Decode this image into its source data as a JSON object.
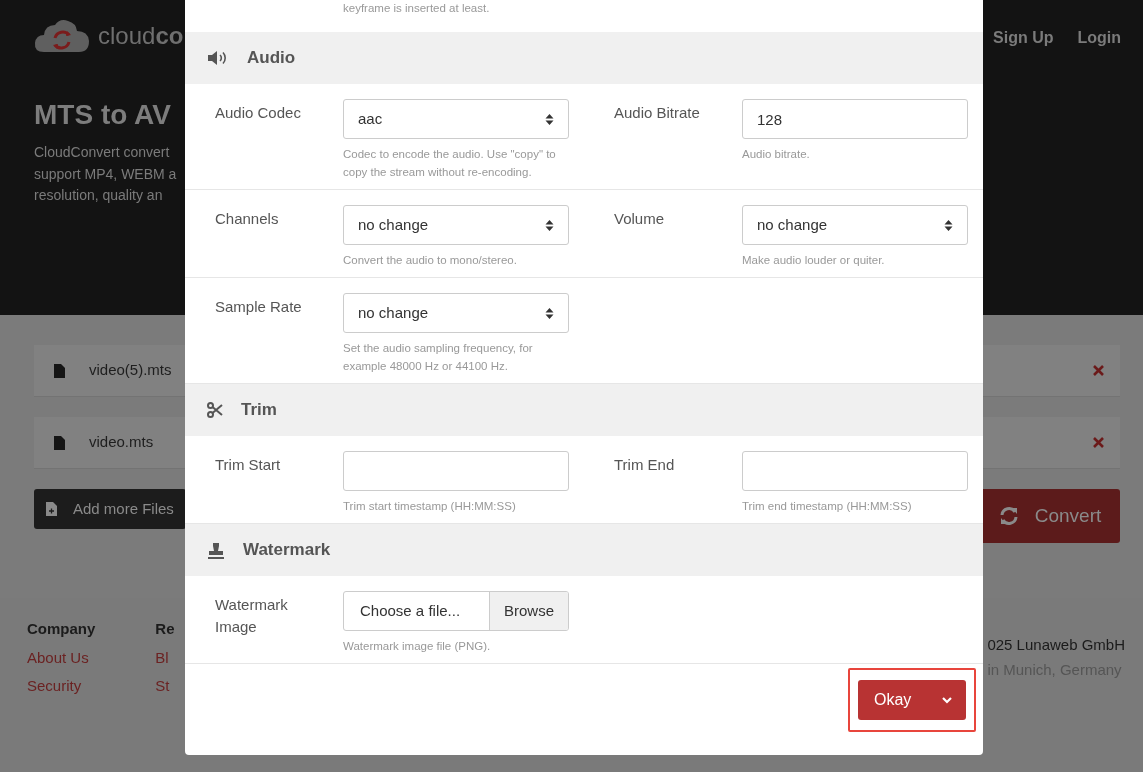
{
  "page": {
    "logo": {
      "regular": "cloud",
      "bold": "co"
    },
    "nav": [
      "Sign Up",
      "Login"
    ],
    "title": "MTS to AV",
    "description": [
      "CloudConvert convert",
      "support MP4, WEBM a",
      "resolution, quality an"
    ],
    "files": [
      {
        "name": "video(5).mts"
      },
      {
        "name": "video.mts"
      }
    ],
    "add_button": "Add more Files",
    "convert_button": "Convert",
    "footer": {
      "columns": [
        {
          "heading": "Company",
          "links": [
            "About Us",
            "Security"
          ]
        },
        {
          "heading": "Re",
          "links": [
            "Bl",
            "St"
          ]
        }
      ],
      "copyright": "025 Lunaweb GmbH",
      "location": "in Munich, Germany"
    }
  },
  "dialog": {
    "top_note": "keyframe is inserted at least.",
    "sections": [
      {
        "title": "Audio",
        "rows": [
          [
            {
              "label": "Audio Codec",
              "kind": "select",
              "value": "aac",
              "help": "Codec to encode the audio. Use \"copy\" to copy the stream without re-encoding."
            },
            {
              "label": "Audio Bitrate",
              "kind": "text",
              "value": "128",
              "help": "Audio bitrate."
            }
          ],
          [
            {
              "label": "Channels",
              "kind": "select",
              "value": "no change",
              "help": "Convert the audio to mono/stereo."
            },
            {
              "label": "Volume",
              "kind": "select",
              "value": "no change",
              "help": "Make audio louder or quiter."
            }
          ],
          [
            {
              "label": "Sample Rate",
              "kind": "select",
              "value": "no change",
              "help": "Set the audio sampling frequency, for example 48000 Hz or 44100 Hz."
            }
          ]
        ]
      },
      {
        "title": "Trim",
        "rows": [
          [
            {
              "label": "Trim Start",
              "kind": "text",
              "help": "Trim start timestamp (HH:MM:SS)"
            },
            {
              "label": "Trim End",
              "kind": "text",
              "help": "Trim end timestamp (HH:MM:SS)"
            }
          ]
        ]
      },
      {
        "title": "Watermark",
        "rows": [
          [
            {
              "label": "Watermark Image",
              "kind": "file",
              "placeholder": "Choose a file...",
              "button": "Browse",
              "help": "Watermark image file (PNG)."
            }
          ]
        ]
      }
    ],
    "okay_button": {
      "label": "Okay",
      "highlighted": true
    }
  }
}
